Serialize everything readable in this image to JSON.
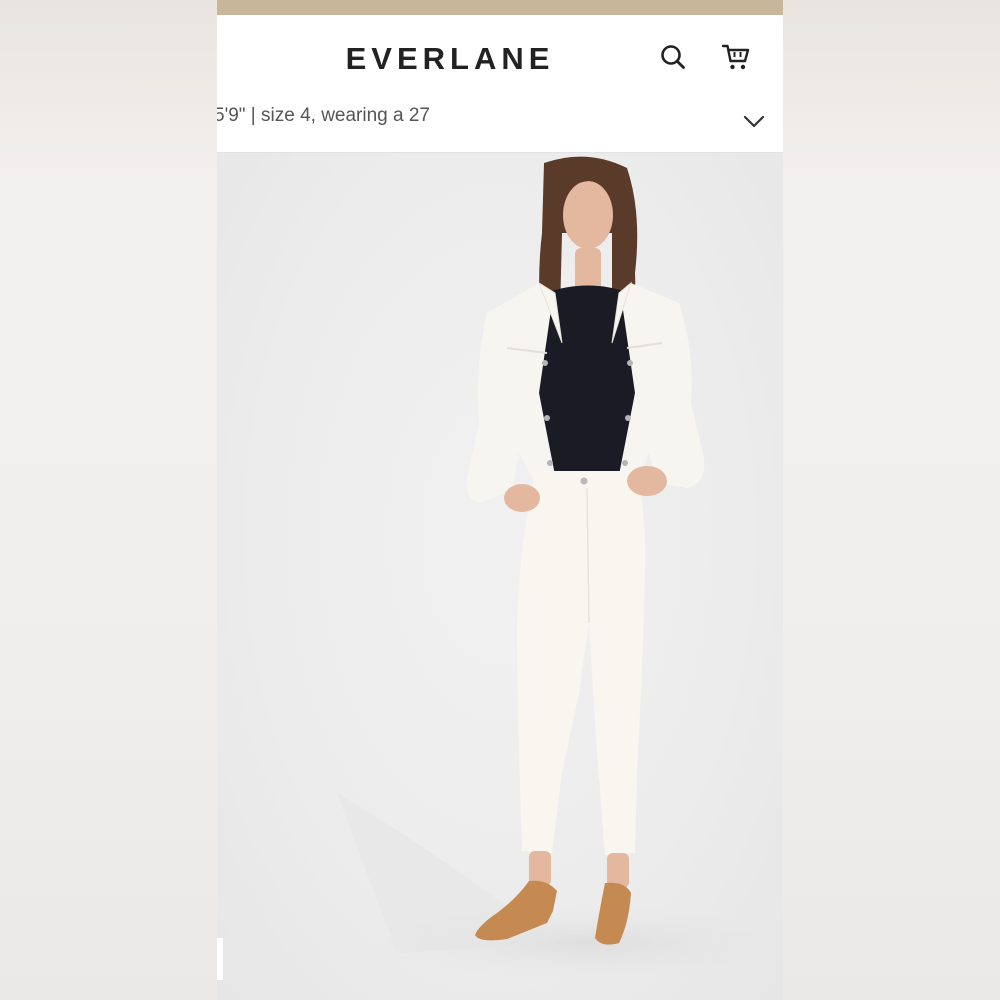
{
  "colors": {
    "top_strip": "#c8b69b",
    "header_bg": "#ffffff",
    "logo_text": "#222222",
    "icon_stroke": "#222222",
    "photo_bg": "#ededed",
    "jacket": "#f7f5ef",
    "top_shirt": "#1a1b24",
    "pants": "#f8f6ef",
    "hair": "#5a3a28",
    "skin": "#e3b89f",
    "shoes": "#c48a52"
  },
  "header": {
    "logo": "EVERLANE",
    "search_icon": "search-icon",
    "cart_icon": "cart-icon"
  },
  "details": {
    "text": "5'9\" | size 4, wearing a 27",
    "toggle_icon": "chevron-down-icon"
  },
  "product_image": {
    "subject": "model wearing white denim jacket, black top, white cropped jeans and tan mules"
  }
}
